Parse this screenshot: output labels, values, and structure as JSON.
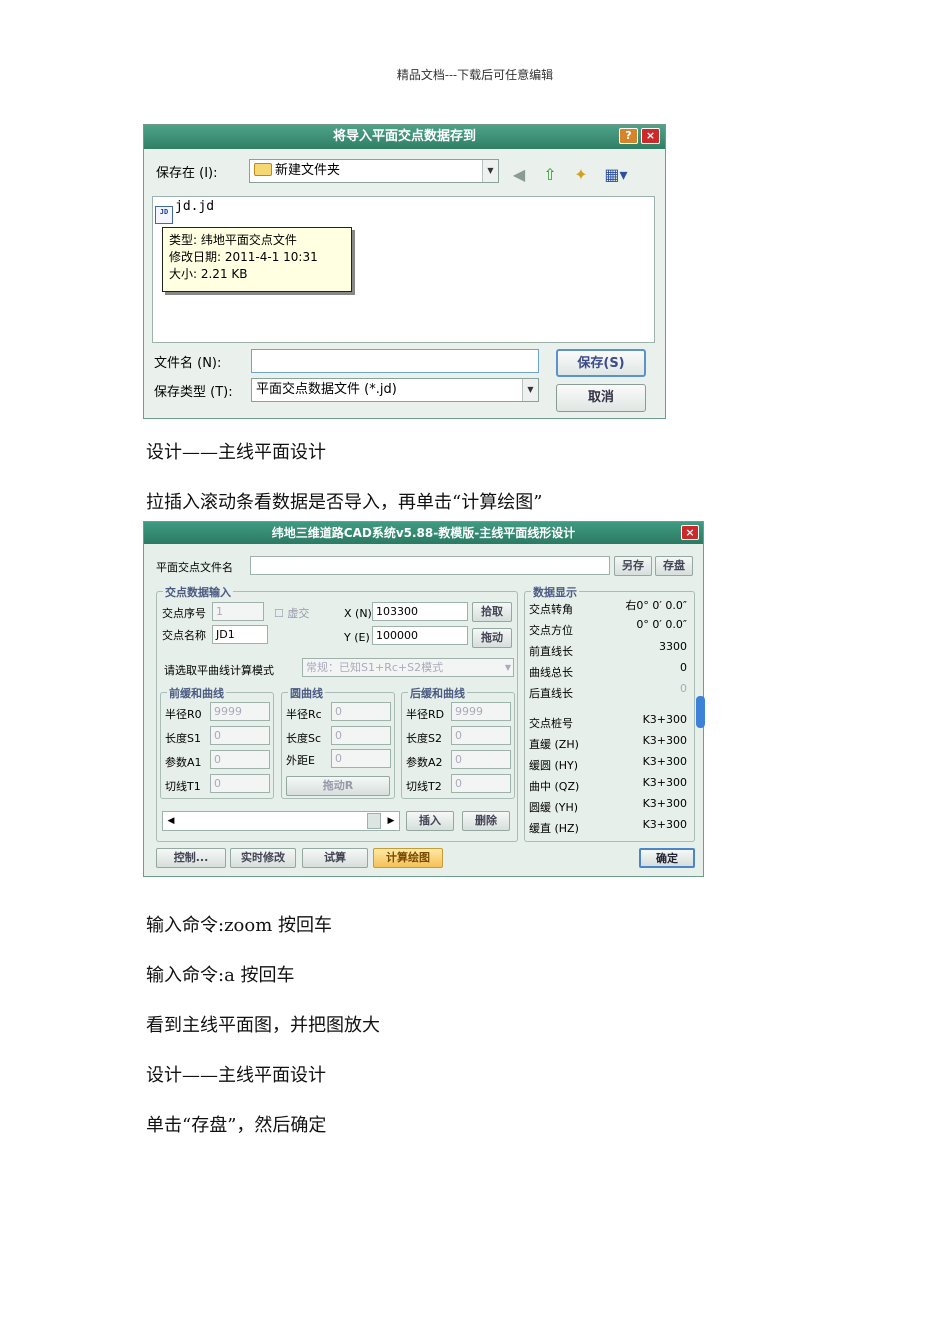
{
  "header": "精品文档---下载后可任意编辑",
  "save_dialog": {
    "title": "将导入平面交点数据存到",
    "help_btn": "?",
    "close_btn": "×",
    "save_in_label": "保存在 (I):",
    "save_in_value": "新建文件夹",
    "file_name": "jd.jd",
    "file_icon_text": "JD",
    "tooltip": {
      "type": "类型: 纬地平面交点文件",
      "modified": "修改日期: 2011-4-1 10:31",
      "size": "大小: 2.21 KB"
    },
    "filename_label": "文件名 (N):",
    "filename_value": "",
    "filetype_label": "保存类型 (T):",
    "filetype_value": "平面交点数据文件 (*.jd)",
    "save_button": "保存(S)",
    "cancel_button": "取消"
  },
  "paragraphs": {
    "p1": "设计——主线平面设计",
    "p2": "拉插入滚动条看数据是否导入，再单击“计算绘图”",
    "p3": "输入命令:zoom  按回车",
    "p4": "输入命令:a    按回车",
    "p5": "看到主线平面图，并把图放大",
    "p6": "设计——主线平面设计",
    "p7": "单击“存盘”，然后确定"
  },
  "design_dialog": {
    "title": "纬地三维道路CAD系统v5.88-教模版-主线平面线形设计",
    "close_btn": "×",
    "file_label": "平面交点文件名",
    "file_value": "",
    "save_as_button": "另存",
    "save_button": "存盘",
    "input_group": {
      "title": "交点数据输入",
      "seq_label": "交点序号",
      "seq_value": "1",
      "virtual_label": "虚交",
      "name_label": "交点名称",
      "name_value": "JD1",
      "x_label": "X (N)",
      "x_value": "103300",
      "y_label": "Y (E)",
      "y_value": "100000",
      "pick_button": "拾取",
      "drag_button": "拖动",
      "mode_label": "请选取平曲线计算模式",
      "mode_value": "常规：已知S1+Rc+S2模式"
    },
    "front_group": {
      "title": "前缓和曲线",
      "r_label": "半径R0",
      "r_value": "9999",
      "s_label": "长度S1",
      "s_value": "0",
      "a_label": "参数A1",
      "a_value": "0",
      "t_label": "切线T1",
      "t_value": "0"
    },
    "circle_group": {
      "title": "圆曲线",
      "r_label": "半径Rc",
      "r_value": "0",
      "s_label": "长度Sc",
      "s_value": "0",
      "e_label": "外距E",
      "e_value": "0",
      "drag_r_button": "拖动R"
    },
    "back_group": {
      "title": "后缓和曲线",
      "r_label": "半径RD",
      "r_value": "9999",
      "s_label": "长度S2",
      "s_value": "0",
      "a_label": "参数A2",
      "a_value": "0",
      "t_label": "切线T2",
      "t_value": "0"
    },
    "insert_button": "插入",
    "delete_button": "删除",
    "display_group": {
      "title": "数据显示",
      "rows": [
        {
          "label": "交点转角",
          "value": "右0° 0′ 0.0″"
        },
        {
          "label": "交点方位",
          "value": "0° 0′ 0.0″"
        },
        {
          "label": "前直线长",
          "value": "3300"
        },
        {
          "label": "曲线总长",
          "value": "0"
        },
        {
          "label": "后直线长",
          "value": "0"
        },
        {
          "label": "交点桩号",
          "value": "K3+300"
        },
        {
          "label": "直缓 (ZH)",
          "value": "K3+300"
        },
        {
          "label": "缓圆 (HY)",
          "value": "K3+300"
        },
        {
          "label": "曲中 (QZ)",
          "value": "K3+300"
        },
        {
          "label": "圆缓 (YH)",
          "value": "K3+300"
        },
        {
          "label": "缓直 (HZ)",
          "value": "K3+300"
        }
      ]
    },
    "bottom_buttons": {
      "control": "控制...",
      "realtime": "实时修改",
      "trial": "试算",
      "calc": "计算绘图",
      "ok": "确定"
    }
  },
  "colors": {
    "titlebar": "#2f7f66",
    "dialog_bg": "#e6efea",
    "tooltip_bg": "#ffffe1",
    "accent_blue": "#4d86c8"
  }
}
